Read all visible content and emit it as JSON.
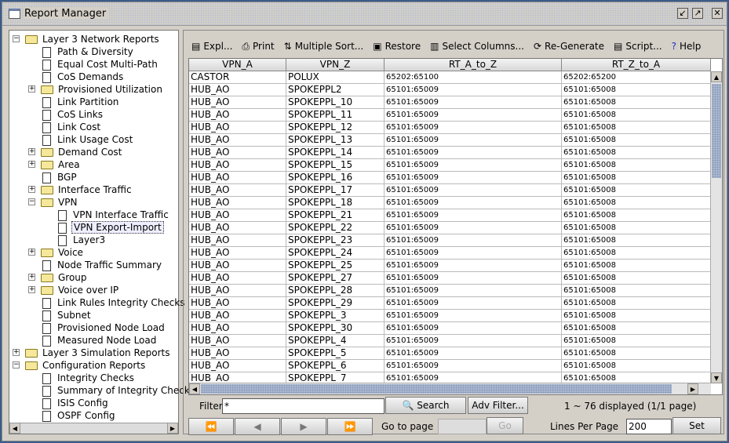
{
  "window": {
    "title": "Report Manager"
  },
  "tree": [
    {
      "label": "Layer 3 Network Reports",
      "level": 0,
      "type": "folder",
      "expanded": true
    },
    {
      "label": "Path & Diversity",
      "level": 1,
      "type": "doc"
    },
    {
      "label": "Equal Cost Multi-Path",
      "level": 1,
      "type": "doc"
    },
    {
      "label": "CoS Demands",
      "level": 1,
      "type": "doc"
    },
    {
      "label": "Provisioned Utilization",
      "level": 1,
      "type": "folder",
      "expanded": false
    },
    {
      "label": "Link Partition",
      "level": 1,
      "type": "doc"
    },
    {
      "label": "CoS Links",
      "level": 1,
      "type": "doc"
    },
    {
      "label": "Link Cost",
      "level": 1,
      "type": "doc"
    },
    {
      "label": "Link Usage Cost",
      "level": 1,
      "type": "doc"
    },
    {
      "label": "Demand Cost",
      "level": 1,
      "type": "folder",
      "expanded": false
    },
    {
      "label": "Area",
      "level": 1,
      "type": "folder",
      "expanded": false
    },
    {
      "label": "BGP",
      "level": 1,
      "type": "doc"
    },
    {
      "label": "Interface Traffic",
      "level": 1,
      "type": "folder",
      "expanded": false
    },
    {
      "label": "VPN",
      "level": 1,
      "type": "folder",
      "expanded": true
    },
    {
      "label": "VPN Interface Traffic",
      "level": 2,
      "type": "doc"
    },
    {
      "label": "VPN Export-Import",
      "level": 2,
      "type": "doc",
      "selected": true
    },
    {
      "label": "Layer3",
      "level": 2,
      "type": "doc"
    },
    {
      "label": "Voice",
      "level": 1,
      "type": "folder",
      "expanded": false
    },
    {
      "label": "Node Traffic Summary",
      "level": 1,
      "type": "doc"
    },
    {
      "label": "Group",
      "level": 1,
      "type": "folder",
      "expanded": false
    },
    {
      "label": "Voice over IP",
      "level": 1,
      "type": "folder",
      "expanded": false
    },
    {
      "label": "Link Rules Integrity Checks",
      "level": 1,
      "type": "doc"
    },
    {
      "label": "Subnet",
      "level": 1,
      "type": "doc"
    },
    {
      "label": "Provisioned Node Load",
      "level": 1,
      "type": "doc"
    },
    {
      "label": "Measured Node Load",
      "level": 1,
      "type": "doc"
    },
    {
      "label": "Layer 3 Simulation Reports",
      "level": 0,
      "type": "folder",
      "expanded": false
    },
    {
      "label": "Configuration Reports",
      "level": 0,
      "type": "folder",
      "expanded": true
    },
    {
      "label": "Integrity Checks",
      "level": 1,
      "type": "doc"
    },
    {
      "label": "Summary of Integrity Checks",
      "level": 1,
      "type": "doc"
    },
    {
      "label": "ISIS Config",
      "level": 1,
      "type": "doc"
    },
    {
      "label": "OSPF Config",
      "level": 1,
      "type": "doc"
    }
  ],
  "toolbar": [
    {
      "label": "Expl...",
      "icon": "document-icon",
      "glyph": "▤"
    },
    {
      "label": "Print",
      "icon": "printer-icon",
      "glyph": "⎙"
    },
    {
      "label": "Multiple Sort...",
      "icon": "sort-icon",
      "glyph": "⇅"
    },
    {
      "label": "Restore",
      "icon": "restore-icon",
      "glyph": "▣"
    },
    {
      "label": "Select Columns...",
      "icon": "columns-icon",
      "glyph": "▥"
    },
    {
      "label": "Re-Generate",
      "icon": "refresh-icon",
      "glyph": "⟳"
    },
    {
      "label": "Script...",
      "icon": "script-icon",
      "glyph": "▤"
    },
    {
      "label": "Help",
      "icon": "help-icon",
      "glyph": "?"
    }
  ],
  "table": {
    "columns": [
      "VPN_A",
      "VPN_Z",
      "RT_A_to_Z",
      "RT_Z_to_A"
    ],
    "rows": [
      [
        "CASTOR",
        "POLUX",
        "65202:65100",
        "65202:65200"
      ],
      [
        "HUB_AO",
        "SPOKEPPL2",
        "65101:65009",
        "65101:65008"
      ],
      [
        "HUB_AO",
        "SPOKEPPL_10",
        "65101:65009",
        "65101:65008"
      ],
      [
        "HUB_AO",
        "SPOKEPPL_11",
        "65101:65009",
        "65101:65008"
      ],
      [
        "HUB_AO",
        "SPOKEPPL_12",
        "65101:65009",
        "65101:65008"
      ],
      [
        "HUB_AO",
        "SPOKEPPL_13",
        "65101:65009",
        "65101:65008"
      ],
      [
        "HUB_AO",
        "SPOKEPPL_14",
        "65101:65009",
        "65101:65008"
      ],
      [
        "HUB_AO",
        "SPOKEPPL_15",
        "65101:65009",
        "65101:65008"
      ],
      [
        "HUB_AO",
        "SPOKEPPL_16",
        "65101:65009",
        "65101:65008"
      ],
      [
        "HUB_AO",
        "SPOKEPPL_17",
        "65101:65009",
        "65101:65008"
      ],
      [
        "HUB_AO",
        "SPOKEPPL_18",
        "65101:65009",
        "65101:65008"
      ],
      [
        "HUB_AO",
        "SPOKEPPL_21",
        "65101:65009",
        "65101:65008"
      ],
      [
        "HUB_AO",
        "SPOKEPPL_22",
        "65101:65009",
        "65101:65008"
      ],
      [
        "HUB_AO",
        "SPOKEPPL_23",
        "65101:65009",
        "65101:65008"
      ],
      [
        "HUB_AO",
        "SPOKEPPL_24",
        "65101:65009",
        "65101:65008"
      ],
      [
        "HUB_AO",
        "SPOKEPPL_25",
        "65101:65009",
        "65101:65008"
      ],
      [
        "HUB_AO",
        "SPOKEPPL_27",
        "65101:65009",
        "65101:65008"
      ],
      [
        "HUB_AO",
        "SPOKEPPL_28",
        "65101:65009",
        "65101:65008"
      ],
      [
        "HUB_AO",
        "SPOKEPPL_29",
        "65101:65009",
        "65101:65008"
      ],
      [
        "HUB_AO",
        "SPOKEPPL_3",
        "65101:65009",
        "65101:65008"
      ],
      [
        "HUB_AO",
        "SPOKEPPL_30",
        "65101:65009",
        "65101:65008"
      ],
      [
        "HUB_AO",
        "SPOKEPPL_4",
        "65101:65009",
        "65101:65008"
      ],
      [
        "HUB_AO",
        "SPOKEPPL_5",
        "65101:65009",
        "65101:65008"
      ],
      [
        "HUB_AO",
        "SPOKEPPL_6",
        "65101:65009",
        "65101:65008"
      ],
      [
        "HUB_AO",
        "SPOKEPPL_7",
        "65101:65009",
        "65101:65008"
      ]
    ]
  },
  "filter": {
    "label": "Filter:",
    "value": "*",
    "search": "Search",
    "adv": "Adv Filter...",
    "status": "1 ~ 76 displayed (1/1 page)"
  },
  "paging": {
    "first": "⏪",
    "prev": "◀",
    "next": "▶",
    "last": "⏩",
    "goto_label": "Go to page",
    "goto_value": "",
    "go": "Go",
    "lines_label": "Lines Per Page",
    "lines_value": "200",
    "set": "Set"
  }
}
